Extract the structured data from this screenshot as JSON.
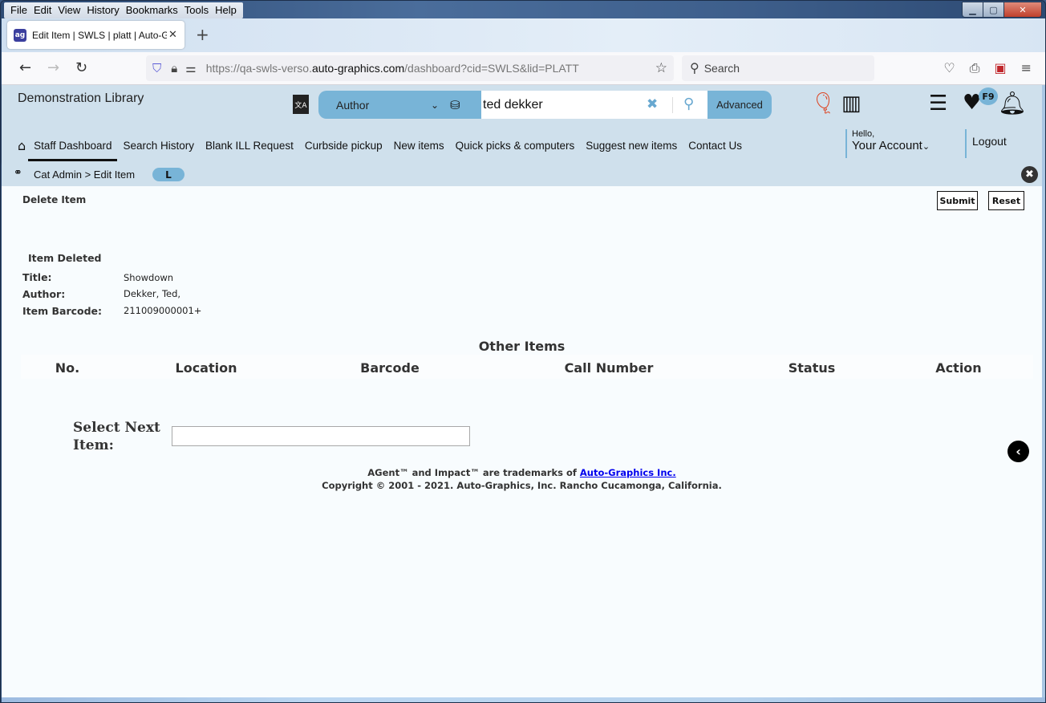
{
  "browser": {
    "menu": [
      "File",
      "Edit",
      "View",
      "History",
      "Bookmarks",
      "Tools",
      "Help"
    ],
    "tab_title": "Edit Item | SWLS | platt | Auto-Graphics",
    "url_prefix": "https://qa-swls-verso.",
    "url_domain": "auto-graphics.com",
    "url_path": "/dashboard?cid=SWLS&lid=PLATT",
    "search_placeholder": "Search"
  },
  "header": {
    "library_name": "Demonstration Library",
    "search_type": "Author",
    "search_query": "ted dekker",
    "advanced_label": "Advanced",
    "badge": "F9",
    "nav": [
      "Staff Dashboard",
      "Search History",
      "Blank ILL Request",
      "Curbside pickup",
      "New items",
      "Quick picks & computers",
      "Suggest new items",
      "Contact Us"
    ],
    "hello": "Hello,",
    "account": "Your Account",
    "logout": "Logout"
  },
  "breadcrumb": {
    "text": "Cat Admin > Edit Item",
    "pill": "L"
  },
  "content": {
    "heading": "Delete Item",
    "submit": "Submit",
    "reset": "Reset",
    "status": "Item Deleted",
    "fields": [
      {
        "label": "Title:",
        "value": "Showdown"
      },
      {
        "label": "Author:",
        "value": "Dekker, Ted,"
      },
      {
        "label": "Item Barcode:",
        "value": "211009000001+"
      }
    ],
    "other_items_title": "Other Items",
    "columns": [
      "No.",
      "Location",
      "Barcode",
      "Call Number",
      "Status",
      "Action"
    ],
    "select_next_label": "Select Next Item:",
    "select_next_value": ""
  },
  "footer": {
    "line1_prefix": "AGent™ and Impact™ are trademarks of ",
    "line1_link": "Auto-Graphics Inc.",
    "line2": "Copyright © 2001 - 2021. Auto-Graphics, Inc. Rancho Cucamonga, California."
  }
}
